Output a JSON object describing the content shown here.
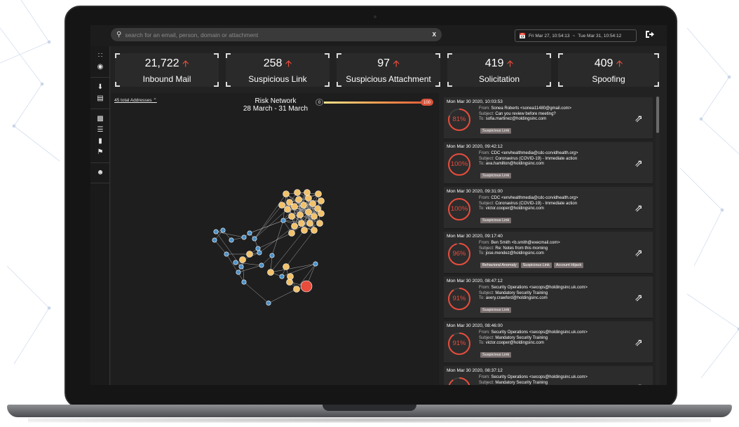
{
  "search": {
    "placeholder": "search for an email, person, domain or attachment",
    "clear_label": "X"
  },
  "date_range": {
    "start": "Fri Mar 27, 10:54:13",
    "separator": "~",
    "end": "Tue Mar 31, 10:54:12"
  },
  "icons": {
    "search": "search-icon",
    "calendar": "calendar-icon",
    "logout": "logout-icon",
    "network": "network-icon",
    "target": "target-icon",
    "download": "download-icon",
    "id_card": "id-card-icon",
    "hierarchy": "hierarchy-icon",
    "list": "list-icon",
    "chat": "chat-icon",
    "flag": "flag-icon",
    "user_settings": "user-settings-icon",
    "open": "external-link-icon"
  },
  "stats": [
    {
      "value": "21,722",
      "label": "Inbound Mail"
    },
    {
      "value": "258",
      "label": "Suspicious Link"
    },
    {
      "value": "97",
      "label": "Suspicious Attachment"
    },
    {
      "value": "419",
      "label": "Solicitation"
    },
    {
      "value": "409",
      "label": "Spoofing"
    }
  ],
  "risk_network": {
    "addresses_label": "45 total Addresses",
    "title": "Risk Network",
    "subtitle": "28 March - 31 March",
    "legend_min": "0",
    "legend_max": "100"
  },
  "colors": {
    "accent_red": "#e74c3c",
    "node_blue": "#4a90c8",
    "node_yellow": "#f2c26a",
    "tag_bg": "#7a6f6f"
  },
  "alerts": [
    {
      "timestamp": "Mon Mar 30 2020, 10:03:53",
      "score": "81%",
      "score_value": 0.81,
      "from": "Sonea Roberts <sonea11480@gmail.com>",
      "subject": "Can you review before meeting?",
      "to": "sofia.martinez@holdingsinc.com",
      "tags": [
        "Suspicious Link"
      ]
    },
    {
      "timestamp": "Mon Mar 30 2020, 09:42:12",
      "score": "100%",
      "score_value": 1.0,
      "from": "CDC <envhealthmedia@cdc-corvidhealth.org>",
      "subject": "Coronavirus (COVID-19) - Immediate action",
      "to": "ava.hamilton@holdingsinc.com",
      "tags": [
        "Suspicious Link"
      ]
    },
    {
      "timestamp": "Mon Mar 30 2020, 09:31:00",
      "score": "100%",
      "score_value": 1.0,
      "from": "CDC <envhealthmedia@cdc-corvidhealth.org>",
      "subject": "Coronavirus (COVID-19) - Immediate action",
      "to": "victor.cooper@holdingsinc.com",
      "tags": [
        "Suspicious Link"
      ]
    },
    {
      "timestamp": "Mon Mar 30 2020, 09:17:40",
      "score": "96%",
      "score_value": 0.96,
      "from": "Ben Smith <b.smith@execmail.com>",
      "subject": "Re: Notes from this morning",
      "to": "jose.mendez@holdingsinc.com",
      "tags": [
        "Behavioral Anomaly",
        "Suspicious Link",
        "Account Hijack"
      ]
    },
    {
      "timestamp": "Mon Mar 30 2020, 08:47:12",
      "score": "91%",
      "score_value": 0.91,
      "from": "Security Operations <secops@holdingsinc.uk.com>",
      "subject": "Mandatory Security Training",
      "to": "avery.crawford@holdingsinc.com",
      "tags": [
        "Suspicious Link"
      ]
    },
    {
      "timestamp": "Mon Mar 30 2020, 08:46:00",
      "score": "91%",
      "score_value": 0.91,
      "from": "Security Operations <secops@holdingsinc.uk.com>",
      "subject": "Mandatory Security Training",
      "to": "victor.cooper@holdingsinc.com",
      "tags": [
        "Suspicious Link"
      ]
    },
    {
      "timestamp": "Mon Mar 30 2020, 08:37:12",
      "score": "",
      "score_value": 0.9,
      "from": "Security Operations <secops@holdingsinc.uk.com>",
      "subject": "Mandatory Security Training",
      "to": "",
      "tags": []
    }
  ],
  "field_labels": {
    "from": "From:",
    "subject": "Subject:",
    "to": "To:"
  }
}
